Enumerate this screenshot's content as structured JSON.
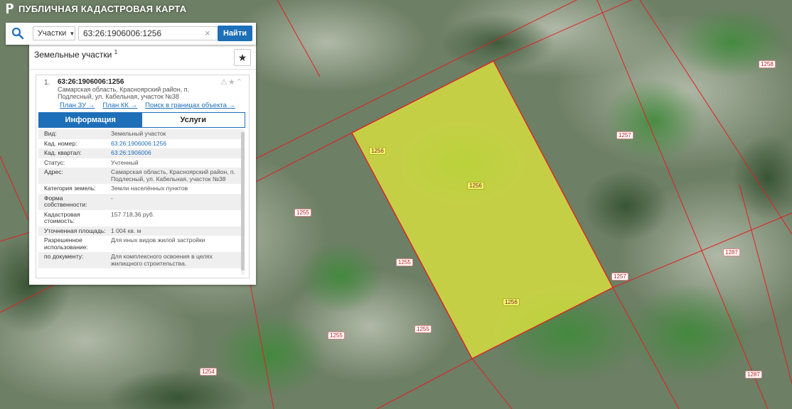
{
  "app": {
    "title": "ПУБЛИЧНАЯ КАДАСТРОВАЯ КАРТА"
  },
  "search": {
    "type_label": "Участки",
    "query": "63:26:1906006:1256",
    "button_label": "Найти"
  },
  "results": {
    "section_title": "Земельные участки",
    "count": "1",
    "item": {
      "index": "1.",
      "cadastral_id": "63:26:1906006:1256",
      "address": "Самарская область, Красноярский район, п. Подлесный, ул. Кабельная, участок №38",
      "links": [
        "План ЗУ →",
        "План КК →",
        "Поиск в границах объекта →"
      ]
    },
    "tabs": [
      "Информация",
      "Услуги"
    ],
    "info": [
      {
        "key": "Вид:",
        "value": "Земельный участок",
        "link": false
      },
      {
        "key": "Кад. номер:",
        "value": "63:26:1906006:1256",
        "link": true
      },
      {
        "key": "Кад. квартал:",
        "value": "63:26:1906006",
        "link": true
      },
      {
        "key": "Статус:",
        "value": "Учтенный",
        "link": false
      },
      {
        "key": "Адрес:",
        "value": "Самарская область, Красноярский район, п. Подлесный, ул. Кабельная, участок №38",
        "link": false
      },
      {
        "key": "Категория земель:",
        "value": "Земли населённых пунктов",
        "link": false
      },
      {
        "key": "Форма собственности:",
        "value": "-",
        "link": false
      },
      {
        "key": "Кадастровая стоимость:",
        "value": "157 718,36 руб.",
        "link": false
      },
      {
        "key": "Уточненная площадь:",
        "value": "1 004 кв. м",
        "link": false
      },
      {
        "key": "Разрешенное использование:",
        "value": "Для иных видов жилой застройки",
        "link": false
      },
      {
        "key": "по документу:",
        "value": "Для комплексного освоения в целях жилищного строительства.",
        "link": false
      }
    ]
  },
  "map_labels": [
    {
      "text": "1256",
      "selected": true
    },
    {
      "text": "1256",
      "selected": true
    },
    {
      "text": "1256",
      "selected": true
    },
    {
      "text": "1255",
      "selected": false
    },
    {
      "text": "1255",
      "selected": false
    },
    {
      "text": "1255",
      "selected": false
    },
    {
      "text": "1255",
      "selected": false
    },
    {
      "text": "1254",
      "selected": false
    },
    {
      "text": "1257",
      "selected": false
    },
    {
      "text": "1257",
      "selected": false
    },
    {
      "text": "1258",
      "selected": false
    },
    {
      "text": "1287",
      "selected": false
    },
    {
      "text": "1287",
      "selected": false
    }
  ],
  "colors": {
    "accent": "#1d6fb8",
    "parcel_fill": "#e8ee3a",
    "boundary": "#e02020"
  }
}
